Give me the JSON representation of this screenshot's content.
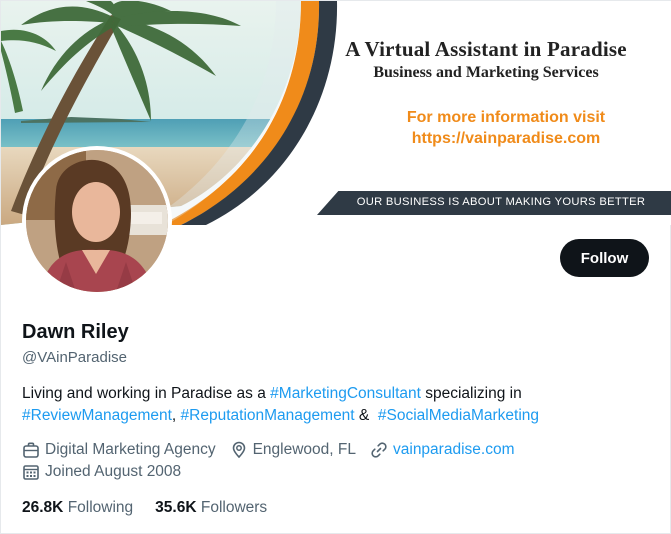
{
  "banner": {
    "title": "A Virtual Assistant in Paradise",
    "subtitle": "Business and Marketing Services",
    "info_line1": "For more information visit",
    "info_line2": "https://vainparadise.com",
    "tagline": "OUR BUSINESS IS ABOUT MAKING YOURS BETTER"
  },
  "profile": {
    "name": "Dawn Riley",
    "handle": "@VAinParadise",
    "follow_label": "Follow"
  },
  "bio": {
    "part1": "Living and working in Paradise as a ",
    "tag1": "#MarketingConsultant",
    "part2": " specializing in ",
    "tag2": "#ReviewManagement",
    "sep1": ", ",
    "tag3": "#ReputationManagement",
    "sep2": " &  ",
    "tag4": "#SocialMediaMarketing"
  },
  "meta": {
    "category": "Digital Marketing Agency",
    "location": "Englewood, FL",
    "website": "vainparadise.com",
    "joined": "Joined August 2008"
  },
  "stats": {
    "following_count": "26.8K",
    "following_label": "Following",
    "followers_count": "35.6K",
    "followers_label": "Followers"
  },
  "colors": {
    "accent": "#1d9bf0",
    "orange": "#f08b1a",
    "dark": "#2f3a45"
  },
  "icons": {
    "category": "briefcase-icon",
    "location": "location-pin-icon",
    "website": "link-icon",
    "joined": "calendar-icon"
  }
}
